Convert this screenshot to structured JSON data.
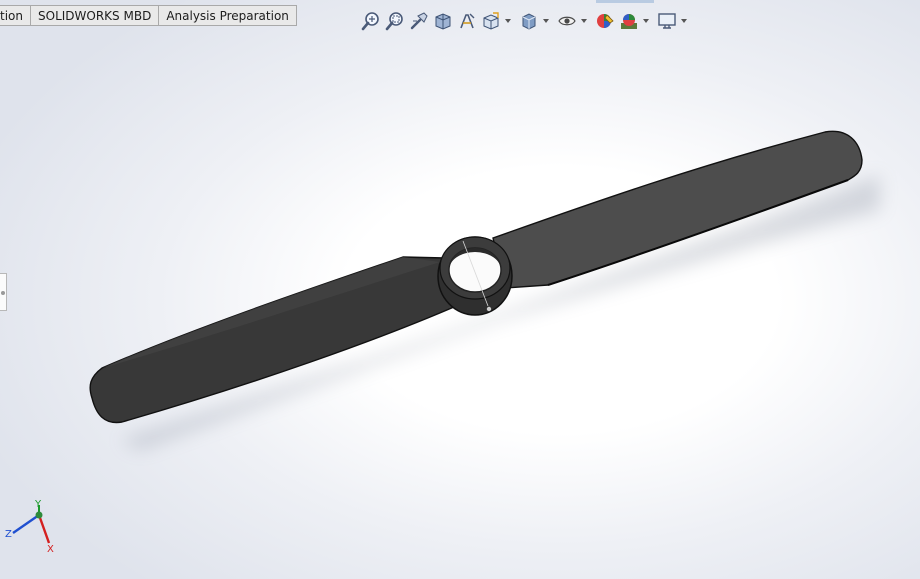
{
  "command_manager": {
    "tabs": [
      {
        "label": "tion"
      },
      {
        "label": "SOLIDWORKS MBD"
      },
      {
        "label": "Analysis Preparation"
      }
    ]
  },
  "view_toolbar": {
    "icons": [
      "zoom-to-fit-icon",
      "zoom-to-area-icon",
      "previous-view-icon",
      "section-view-icon",
      "dynamic-annotation-views-icon",
      "view-orientation-icon",
      "display-style-icon",
      "hide-show-items-icon",
      "edit-appearance-icon",
      "apply-scene-icon",
      "view-settings-icon"
    ]
  },
  "triad": {
    "y_label": "Y",
    "z_label": "Z",
    "x_label": "X",
    "colors": {
      "x": "#d42020",
      "y": "#1a9a2a",
      "z": "#2050d0"
    }
  },
  "model": {
    "part": "propeller",
    "color": "#3f3f3f"
  }
}
